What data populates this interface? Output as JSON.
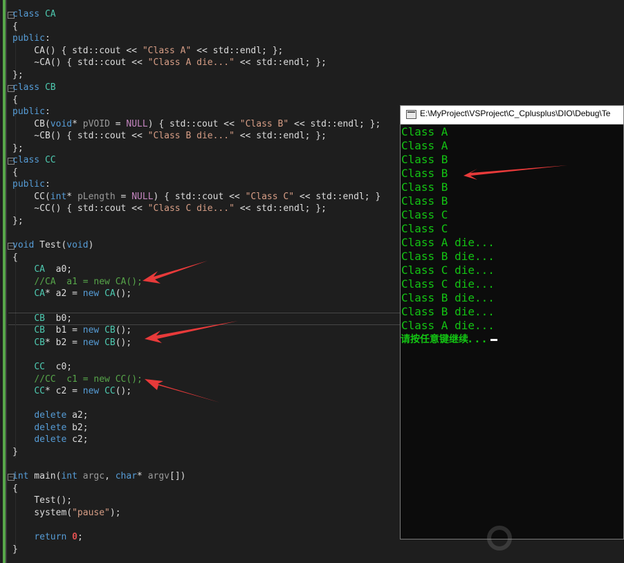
{
  "console": {
    "title": "E:\\MyProject\\VSProject\\C_Cplusplus\\DIO\\Debug\\Te",
    "output": [
      "Class A",
      "Class A",
      "Class B",
      "Class B",
      "Class B",
      "Class B",
      "Class C",
      "Class C",
      "Class A die...",
      "Class B die...",
      "Class C die...",
      "Class C die...",
      "Class B die...",
      "Class B die...",
      "Class A die..."
    ],
    "prompt": "请按任意键继续. . ."
  },
  "colors": {
    "keyword": "#569cd6",
    "type": "#4ec9b0",
    "macro": "#c586c0",
    "string": "#d69d85",
    "comment": "#57a64a",
    "console_text": "#13c313",
    "arrow": "#e83a3a"
  }
}
